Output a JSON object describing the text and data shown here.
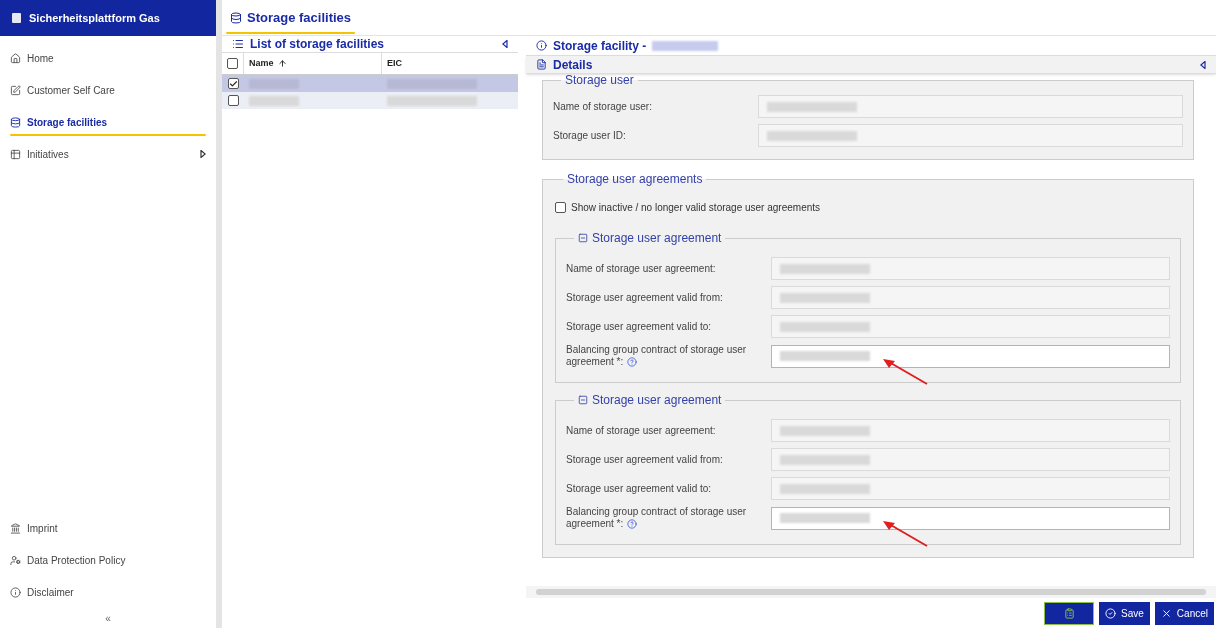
{
  "app": {
    "title": "Sicherheitsplattform Gas"
  },
  "nav": {
    "items": [
      {
        "label": "Home",
        "selected": false,
        "submenu": false
      },
      {
        "label": "Customer Self Care",
        "selected": false,
        "submenu": false
      },
      {
        "label": "Storage facilities",
        "selected": true,
        "submenu": false
      },
      {
        "label": "Initiatives",
        "selected": false,
        "submenu": true
      }
    ],
    "footer": [
      {
        "label": "Imprint"
      },
      {
        "label": "Data Protection Policy"
      },
      {
        "label": "Disclaimer"
      }
    ],
    "collapse": "«"
  },
  "page_tab": {
    "title": "Storage facilities",
    "selected": true
  },
  "list": {
    "title": "List of storage facilities",
    "all_checked": false,
    "columns": [
      {
        "label": "Name",
        "sorted": true
      },
      {
        "label": "EIC",
        "sorted": false
      }
    ],
    "rows": [
      {
        "selected": true,
        "checked": true
      },
      {
        "selected": false,
        "checked": false
      }
    ]
  },
  "detail": {
    "title": "Storage facility -",
    "details_title": "Details",
    "storage_user": {
      "legend": "Storage user",
      "fields": [
        {
          "label": "Name of storage user:",
          "editable": false,
          "annotated": false
        },
        {
          "label": "Storage user ID:",
          "editable": false,
          "annotated": false
        }
      ]
    },
    "agreements": {
      "legend": "Storage user agreements",
      "show_inactive": {
        "label": "Show inactive / no longer valid storage user agreements",
        "checked": false
      },
      "items": [
        {
          "legend": "Storage user agreement",
          "expanded": true,
          "fields": [
            {
              "label": "Name of storage user agreement:",
              "editable": false,
              "annotated": false
            },
            {
              "label": "Storage user agreement valid from:",
              "editable": false,
              "annotated": false
            },
            {
              "label": "Storage user agreement valid to:",
              "editable": false,
              "annotated": false
            },
            {
              "label": "Balancing group contract of storage user agreement *:",
              "editable": true,
              "help": true,
              "annotated": true
            }
          ]
        },
        {
          "legend": "Storage user agreement",
          "expanded": true,
          "fields": [
            {
              "label": "Name of storage user agreement:",
              "editable": false,
              "annotated": false
            },
            {
              "label": "Storage user agreement valid from:",
              "editable": false,
              "annotated": false
            },
            {
              "label": "Storage user agreement valid to:",
              "editable": false,
              "annotated": false
            },
            {
              "label": "Balancing group contract of storage user agreement *:",
              "editable": true,
              "help": true,
              "annotated": true
            }
          ]
        }
      ]
    }
  },
  "buttons": [
    {
      "kind": "clipboard"
    },
    {
      "kind": "save",
      "label": "Save"
    },
    {
      "kind": "cancel",
      "label": "Cancel"
    }
  ]
}
